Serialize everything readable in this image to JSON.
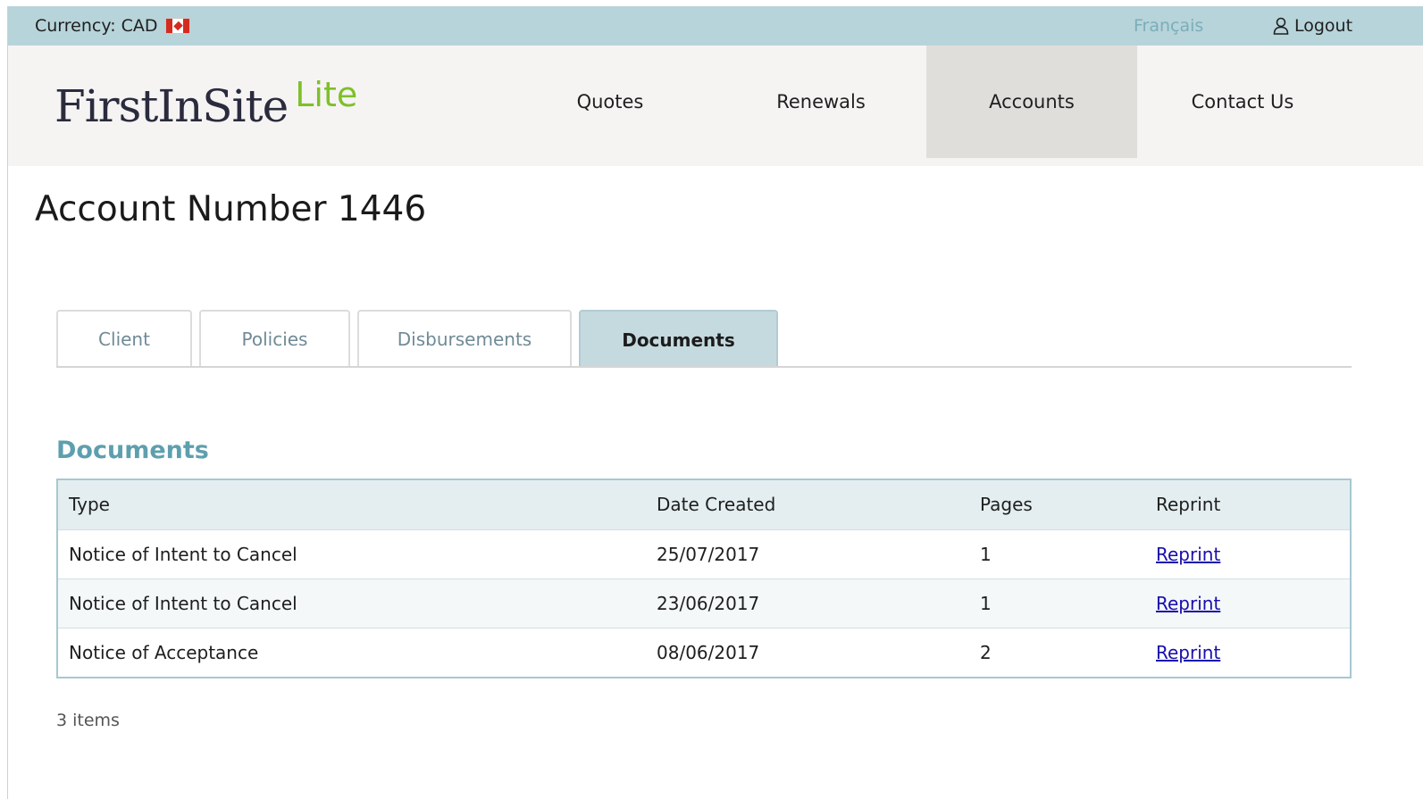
{
  "topbar": {
    "currency_label": "Currency: CAD",
    "language_link": "Français",
    "logout_label": "Logout"
  },
  "header": {
    "logo_main": "FirstInSite",
    "logo_lite": "Lite",
    "nav": [
      "Quotes",
      "Renewals",
      "Accounts",
      "Contact Us"
    ],
    "active_nav": "Accounts"
  },
  "page": {
    "title": "Account Number 1446"
  },
  "tabs": [
    "Client",
    "Policies",
    "Disbursements",
    "Documents"
  ],
  "active_tab": "Documents",
  "documents": {
    "section_title": "Documents",
    "columns": [
      "Type",
      "Date Created",
      "Pages",
      "Reprint"
    ],
    "rows": [
      {
        "type": "Notice of Intent to Cancel",
        "date": "25/07/2017",
        "pages": "1",
        "reprint": "Reprint"
      },
      {
        "type": "Notice of Intent to Cancel",
        "date": "23/06/2017",
        "pages": "1",
        "reprint": "Reprint"
      },
      {
        "type": "Notice of Acceptance",
        "date": "08/06/2017",
        "pages": "2",
        "reprint": "Reprint"
      }
    ],
    "items_count": "3 items"
  },
  "colors": {
    "topbar_bg": "#b7d4da",
    "accent": "#5e9fae",
    "logo_lite": "#7fbf2a",
    "link": "#1a0dab"
  }
}
